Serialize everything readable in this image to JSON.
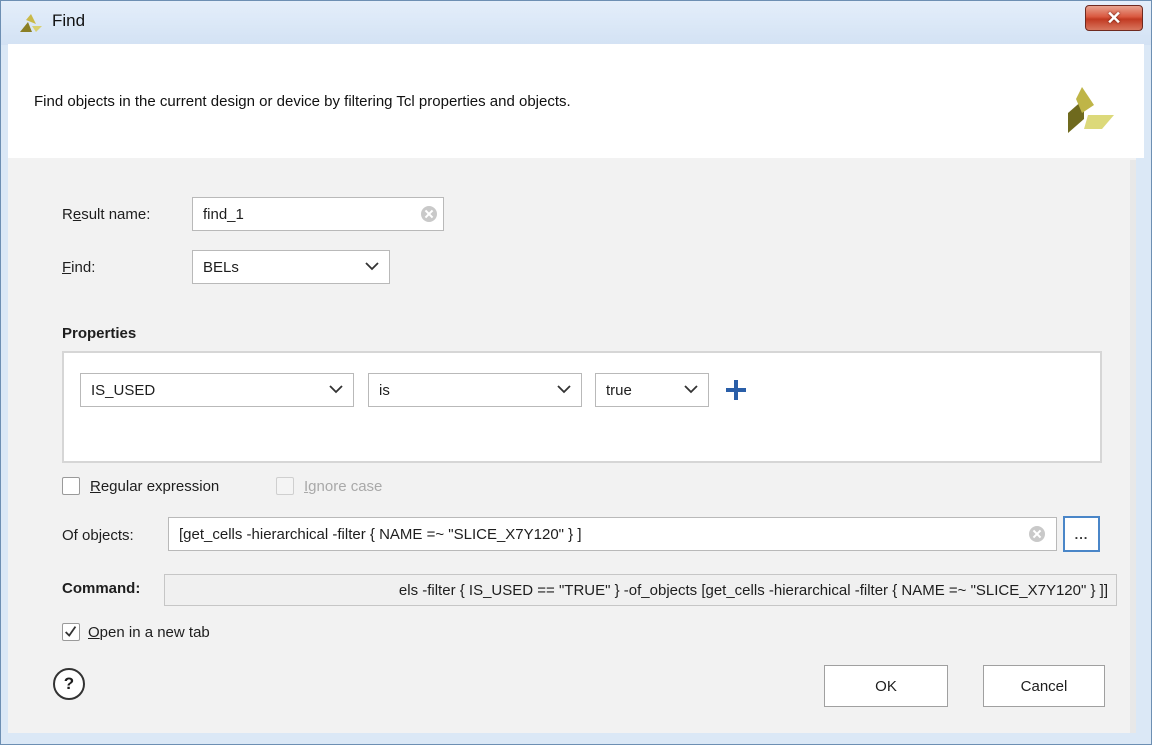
{
  "window": {
    "title": "Find",
    "close_glyph": "✕"
  },
  "banner": {
    "description": "Find objects in the current design or device by filtering Tcl properties and objects."
  },
  "result_name": {
    "label_prefix": "R",
    "label_underlined": "e",
    "label_suffix": "sult name:",
    "value": "find_1"
  },
  "find": {
    "label_underlined": "F",
    "label_suffix": "ind:",
    "selected": "BELs"
  },
  "properties": {
    "heading": "Properties",
    "property": "IS_USED",
    "operator": "is",
    "value": "true",
    "add_icon": "plus-icon"
  },
  "options": {
    "regular_expression": {
      "underlined": "R",
      "rest": "egular expression",
      "checked": false,
      "enabled": true
    },
    "ignore_case": {
      "underlined": "I",
      "rest": "gnore case",
      "checked": false,
      "enabled": false
    }
  },
  "of_objects": {
    "label_prefix": "Of ob",
    "label_underlined": "j",
    "label_suffix": "ects:",
    "value": "[get_cells -hierarchical -filter { NAME =~  \"SLICE_X7Y120\" } ]",
    "browse_label": "..."
  },
  "command": {
    "label": "Command:",
    "value": "els -filter { IS_USED == \"TRUE\" }  -of_objects [get_cells -hierarchical -filter { NAME =~  \"SLICE_X7Y120\" } ]]"
  },
  "open_new_tab": {
    "underlined": "O",
    "rest": "pen in a new tab",
    "checked": true
  },
  "buttons": {
    "help": "?",
    "ok": "OK",
    "cancel": "Cancel"
  },
  "colors": {
    "accent": "#4a86c8",
    "plus": "#2a5ea8",
    "logo_dark": "#6f6a1e",
    "logo_light": "#c9c95a"
  }
}
